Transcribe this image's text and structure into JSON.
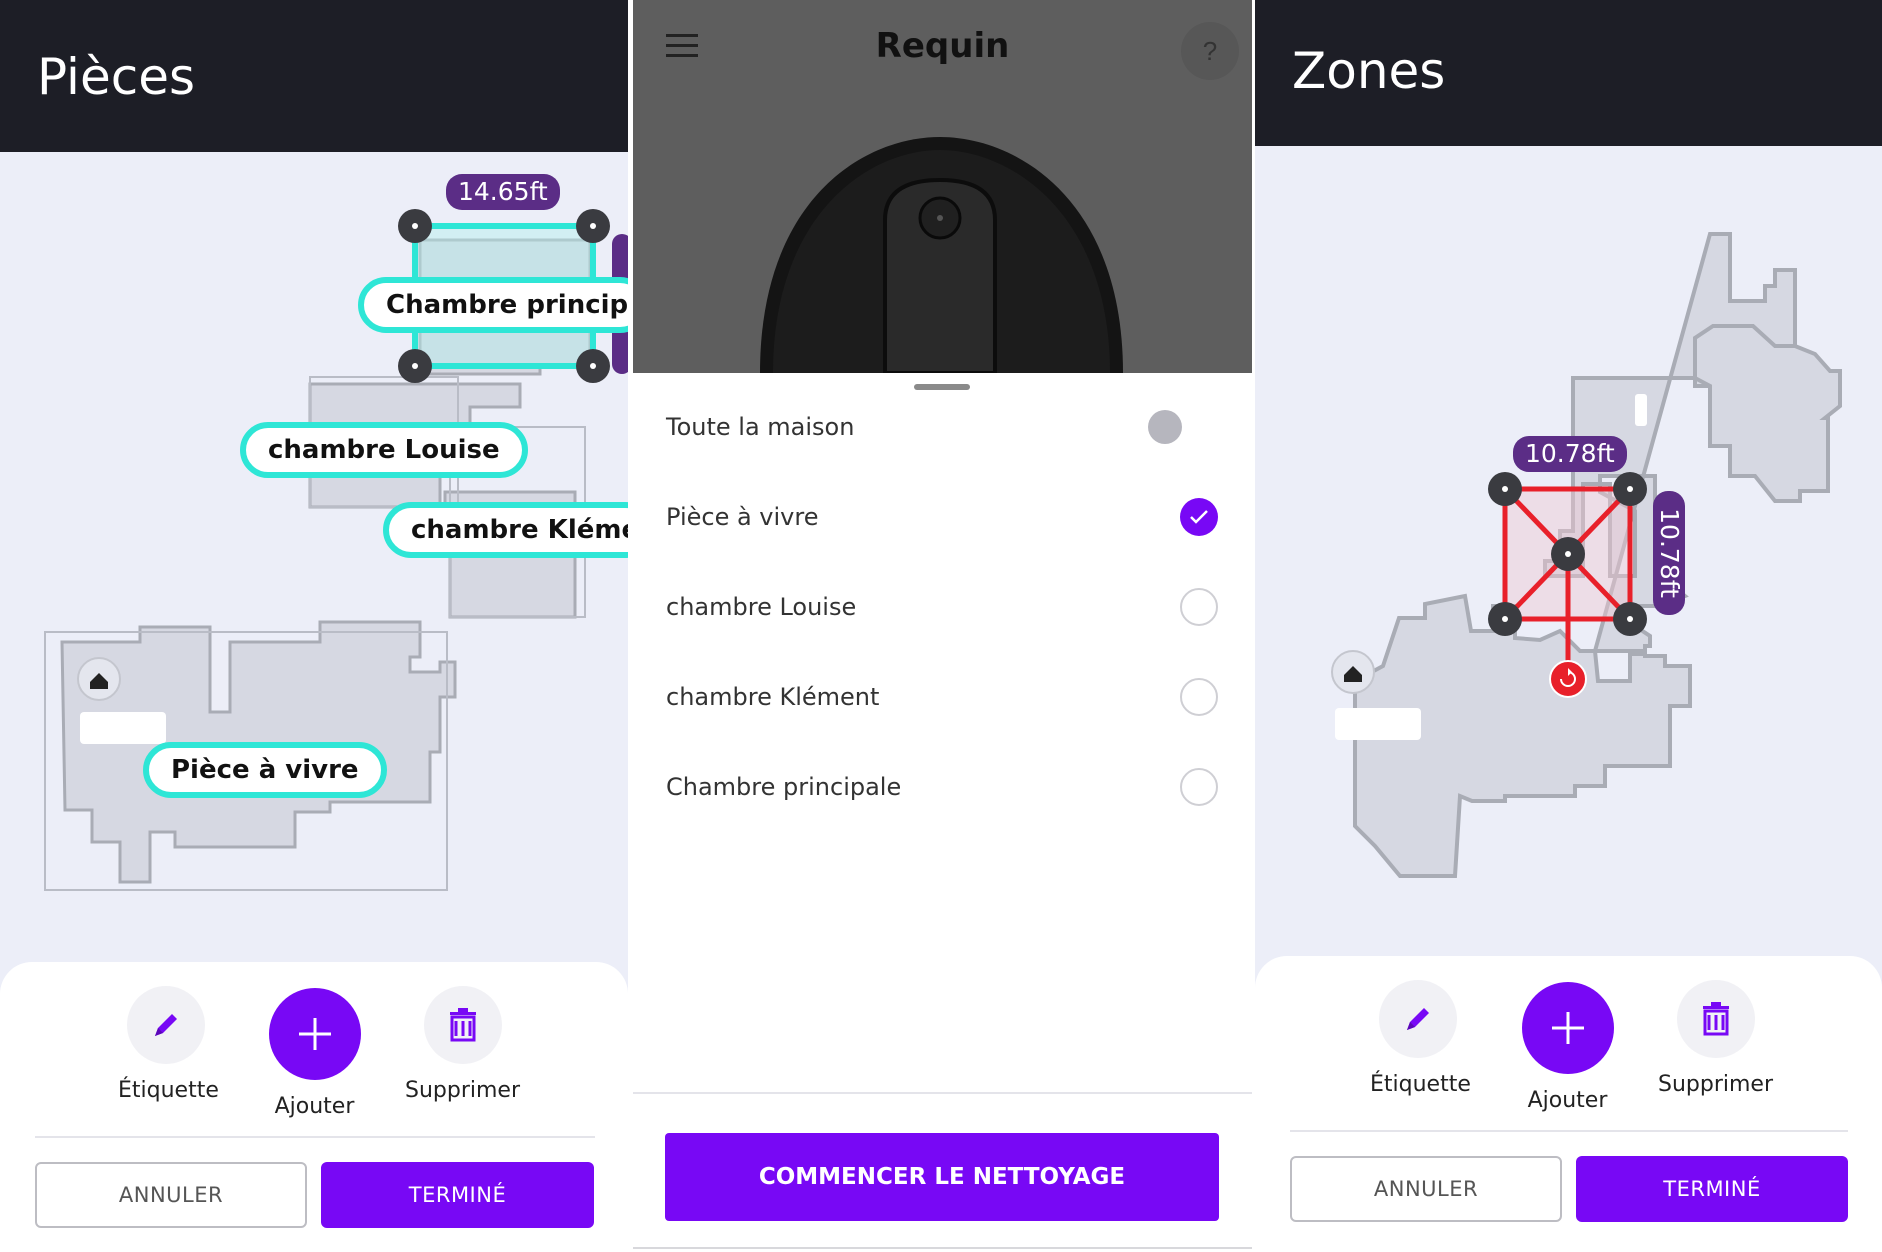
{
  "colors": {
    "accent": "#7808f5",
    "header": "#1d1e26",
    "room_outline": "#2ee6d6",
    "zone": "#e8202a",
    "dimension": "#5b2d86"
  },
  "rooms_screen": {
    "title": "Pièces",
    "dimension_width": "14.65ft",
    "room_labels": [
      "Chambre principale",
      "chambre Louise",
      "chambre Klément",
      "Pièce à vivre"
    ],
    "dock_icon": "home-icon",
    "toolbar": {
      "label_btn": "Étiquette",
      "add_btn": "Ajouter",
      "delete_btn": "Supprimer"
    },
    "cancel": "ANNULER",
    "done": "TERMINÉ"
  },
  "clean_screen": {
    "title": "Requin",
    "menu_icon": "hamburger-menu-icon",
    "help": "?",
    "options": [
      {
        "label": "Toute la maison",
        "state": "toggle"
      },
      {
        "label": "Pièce à vivre",
        "state": "checked"
      },
      {
        "label": "chambre Louise",
        "state": "unchecked"
      },
      {
        "label": "chambre Klément",
        "state": "unchecked"
      },
      {
        "label": "Chambre principale",
        "state": "unchecked"
      }
    ],
    "start_button": "COMMENCER LE NETTOYAGE"
  },
  "zones_screen": {
    "title": "Zones",
    "dimension_width": "10.78ft",
    "dimension_height": "10.78ft",
    "toolbar": {
      "label_btn": "Étiquette",
      "add_btn": "Ajouter",
      "delete_btn": "Supprimer"
    },
    "cancel": "ANNULER",
    "done": "TERMINÉ"
  }
}
